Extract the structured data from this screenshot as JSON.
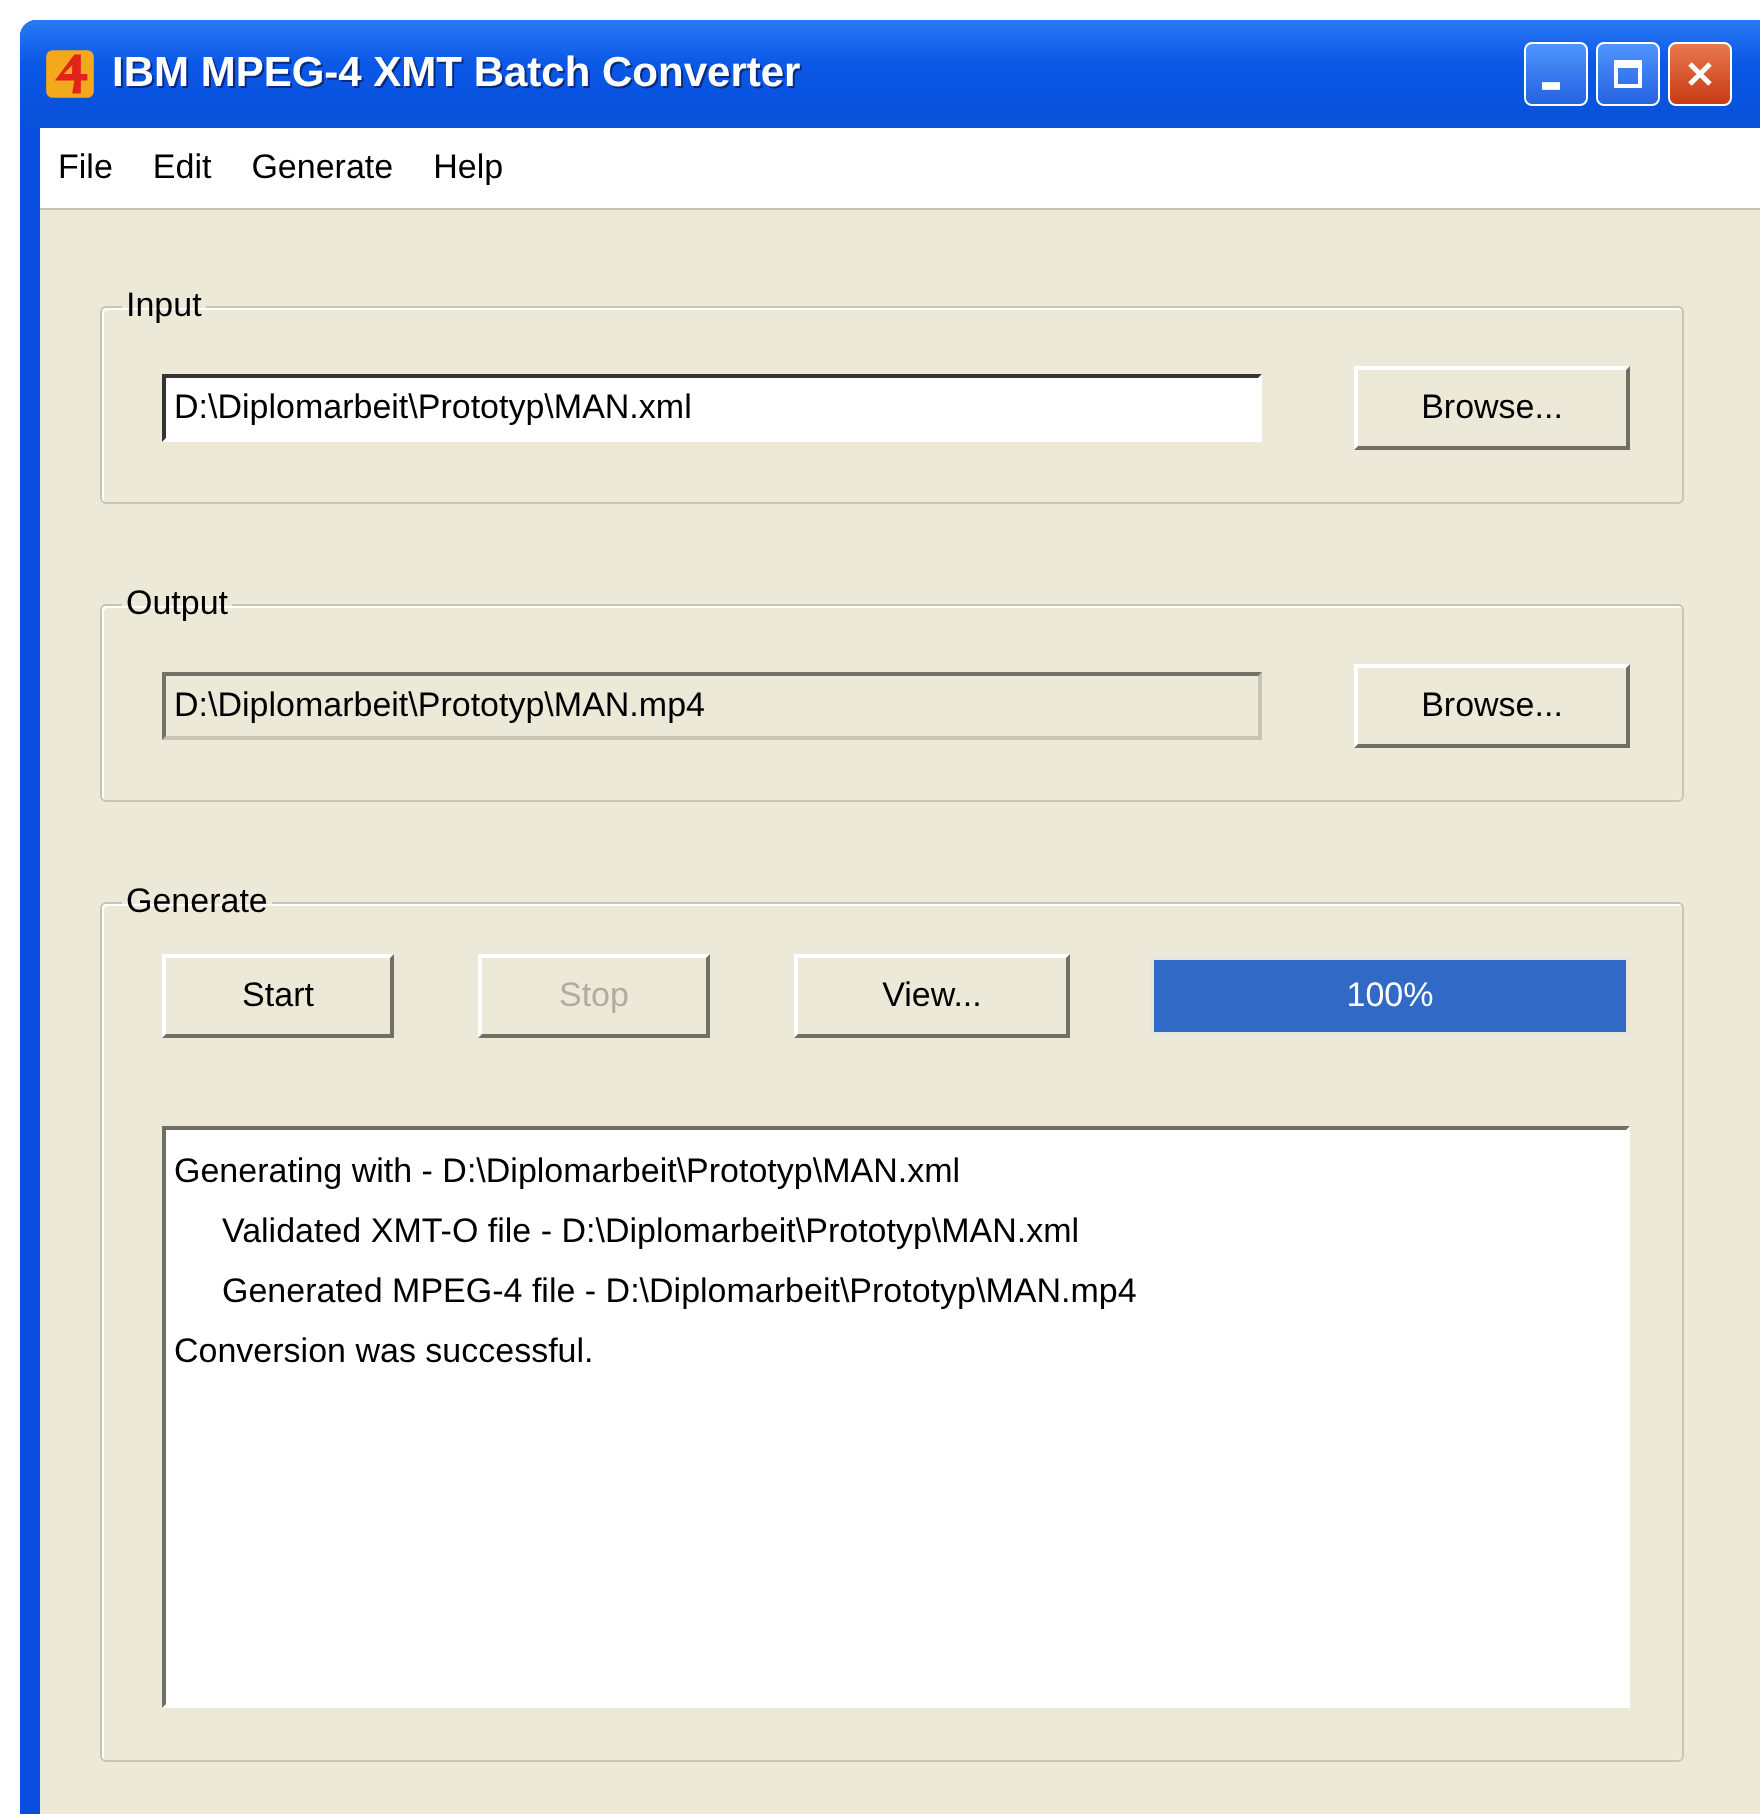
{
  "window": {
    "title": "IBM MPEG-4 XMT Batch Converter"
  },
  "menu": [
    "File",
    "Edit",
    "Generate",
    "Help"
  ],
  "groups": [
    {
      "kind": "file",
      "label": "Input",
      "path": "D:\\Diplomarbeit\\Prototyp\\MAN.xml",
      "disabled": false,
      "button": "Browse..."
    },
    {
      "kind": "file",
      "label": "Output",
      "path": "D:\\Diplomarbeit\\Prototyp\\MAN.mp4",
      "disabled": true,
      "button": "Browse..."
    },
    {
      "kind": "generate",
      "label": "Generate",
      "buttons": [
        {
          "label": "Start",
          "disabled": false
        },
        {
          "label": "Stop",
          "disabled": true
        },
        {
          "label": "View...",
          "disabled": false
        }
      ],
      "progress": {
        "level": 1.0,
        "text": "100%"
      },
      "log": [
        {
          "text": "Generating with - D:\\Diplomarbeit\\Prototyp\\MAN.xml",
          "indent": false
        },
        {
          "text": "Validated XMT-O file - D:\\Diplomarbeit\\Prototyp\\MAN.xml",
          "indent": true
        },
        {
          "text": "Generated MPEG-4 file - D:\\Diplomarbeit\\Prototyp\\MAN.mp4",
          "indent": true
        },
        {
          "text": "Conversion was successful.",
          "indent": false
        }
      ]
    }
  ]
}
